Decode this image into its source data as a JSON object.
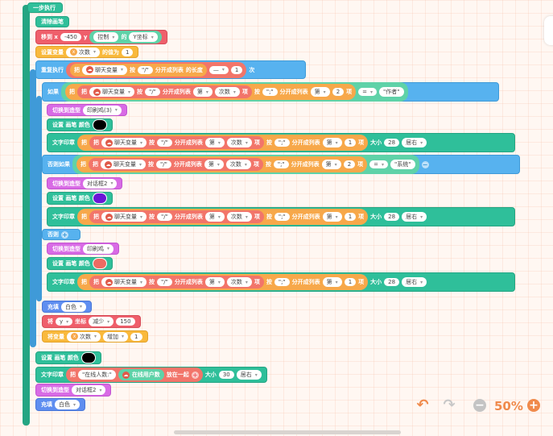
{
  "blocks": {
    "step": "一步执行",
    "clear": "清除画笔",
    "move": {
      "label": "移到 x",
      "x": "-450",
      "y_label": "y",
      "src": "控制",
      "of": "的",
      "prop": "Y坐标"
    },
    "setvar": {
      "label": "设置变量",
      "var": "次数",
      "to": "的值为",
      "val": "1"
    },
    "repeat": {
      "label": "重复执行",
      "take": "把",
      "chatvar": "聊天变量",
      "by": "按",
      "sep": "\"/\"",
      "split": "分开成列表",
      "length": "的长度",
      "minus": "—",
      "one": "1",
      "times": "次"
    },
    "if": {
      "label": "如果",
      "take": "把",
      "chatvar": "聊天变量",
      "by": "按",
      "sep1": "\"/\"",
      "split": "分开成列表",
      "nth": "第",
      "var": "次数",
      "item": "项",
      "sep2": "\";\"",
      "idx": "2",
      "eq": "=",
      "val": "\"作者\""
    },
    "switch1": {
      "label": "切换到造型",
      "costume": "印刷鸡(3)"
    },
    "pen1": {
      "label": "设置 画笔 颜色"
    },
    "print1": {
      "label": "文字印章",
      "size_label": "大小",
      "size": "28",
      "align": "居右",
      "idx": "1"
    },
    "elif": {
      "label": "否则如果",
      "val": "\"系统\"",
      "idx": "2",
      "eq": "="
    },
    "switch2": {
      "label": "切换到造型",
      "costume": "对话框2"
    },
    "pen2": {
      "label": "设置 画笔 颜色"
    },
    "print2": {
      "label": "文字印章",
      "size_label": "大小",
      "size": "28",
      "align": "居右",
      "idx": "1"
    },
    "else": "否则",
    "switch3": {
      "label": "切换到造型",
      "costume": "印刷鸡"
    },
    "pen3": {
      "label": "设置 画笔 颜色"
    },
    "print3": {
      "label": "文字印章",
      "size_label": "大小",
      "size": "28",
      "align": "居右",
      "idx": "1"
    },
    "fill1": {
      "label": "充填",
      "color": "白色"
    },
    "coord": {
      "label": "将",
      "axis": "y",
      "coord": "坐标",
      "op": "减少",
      "val": "150"
    },
    "incvar": {
      "label": "将变量",
      "var": "次数",
      "op": "增加",
      "val": "1"
    },
    "pen4": {
      "label": "设置 画笔 颜色"
    },
    "print4": {
      "label": "文字印章",
      "take": "把",
      "text": "\"在线人数:\"",
      "online": "在线用户数",
      "join": "放在一起",
      "size_label": "大小",
      "size": "30",
      "align": "居右"
    },
    "switch4": {
      "label": "切换到造型",
      "costume": "对话框2"
    },
    "fill2": {
      "label": "充填",
      "color": "白色"
    }
  },
  "common": {
    "take": "把",
    "chatvar": "聊天变量",
    "by": "按",
    "sep1": "\"/\"",
    "split": "分开成列表",
    "nth": "第",
    "var": "次数",
    "item": "项",
    "sep2": "\";\""
  },
  "zoom": {
    "level": "50%"
  },
  "colors": {
    "green": "#2fbf9a",
    "red": "#ef5f6b",
    "orange": "#f9b93c",
    "blue": "#57b2ef",
    "purple": "#d86be5",
    "indigo": "#5f8ef0",
    "pen1": "#000000",
    "pen2": "#6a16d6",
    "pen3": "#ee6b63",
    "pen4": "#000000"
  },
  "icons": [
    "undo-icon",
    "redo-icon",
    "zoom-out-icon",
    "zoom-in-icon"
  ]
}
